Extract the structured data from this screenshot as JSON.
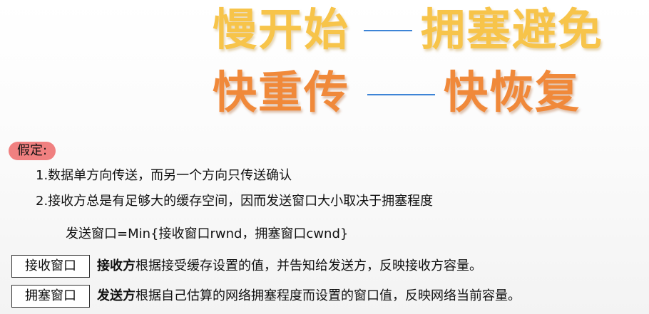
{
  "title": {
    "row1": {
      "left": "慢开始",
      "right": "拥塞避免"
    },
    "row2": {
      "left": "快重传",
      "right": "快恢复"
    },
    "row1_color": "#f7c44a",
    "row2_color": "#f0893a",
    "connector_color": "#3d84d6"
  },
  "assumptions": {
    "label": "假定:",
    "items": [
      "1.数据单方向传送，而另一个方向只传送确认",
      "2.接收方总是有足够大的缓存空间，因而发送窗口大小取决于拥塞程度"
    ],
    "formula": "发送窗口=Min{接收窗口rwnd，拥塞窗口cwnd}"
  },
  "definitions": [
    {
      "term": "接收窗口",
      "subject": "接收方",
      "text": "根据接受缓存设置的值，并告知给发送方，反映接收方容量。"
    },
    {
      "term": "拥塞窗口",
      "subject": "发送方",
      "text": "根据自己估算的网络拥塞程度而设置的窗口值，反映网络当前容量。"
    }
  ],
  "label_color": "#f08080"
}
